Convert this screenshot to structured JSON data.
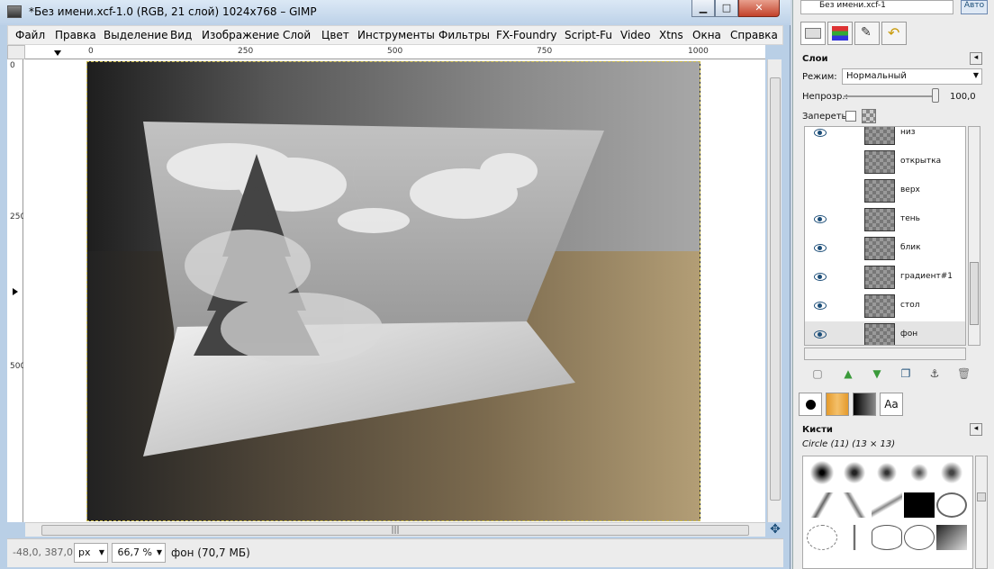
{
  "window": {
    "title": "*Без имени.xcf-1.0 (RGB, 21 слой) 1024x768 – GIMP",
    "min_label": "▁",
    "max_label": "□",
    "close_label": "✕"
  },
  "menu": [
    "Файл",
    "Правка",
    "Выделение",
    "Вид",
    "Изображение",
    "Слой",
    "Цвет",
    "Инструменты",
    "Фильтры",
    "FX-Foundry",
    "Script-Fu",
    "Video",
    "Xtns",
    "Окна",
    "Справка"
  ],
  "ruler": {
    "h_ticks": [
      "0",
      "250",
      "500",
      "750",
      "1000"
    ],
    "v_ticks": [
      "0",
      "250",
      "500"
    ]
  },
  "status": {
    "coords": "-48,0, 387,0",
    "unit": "px",
    "zoom": "66,7 %",
    "info": "фон (70,7 МБ)"
  },
  "dock": {
    "top_field": "Без имени.xcf-1",
    "auto_button": "Авто",
    "layers_title": "Слои",
    "mode_label": "Режим:",
    "mode_value": "Нормальный",
    "opacity_label": "Непрозр.:",
    "opacity_value": "100,0",
    "opacity_level": 1.0,
    "lock_label": "Запереть:",
    "layers": [
      {
        "name": "низ",
        "visible": true
      },
      {
        "name": "открытка",
        "visible": false
      },
      {
        "name": "верх",
        "visible": false
      },
      {
        "name": "тень",
        "visible": true
      },
      {
        "name": "блик",
        "visible": true
      },
      {
        "name": "градиент#1",
        "visible": true
      },
      {
        "name": "стол",
        "visible": true
      },
      {
        "name": "фон",
        "visible": true
      }
    ],
    "brushes_title": "Кисти",
    "brush_info": "Circle (11) (13 × 13)",
    "brush_tab_text": "Aa"
  }
}
